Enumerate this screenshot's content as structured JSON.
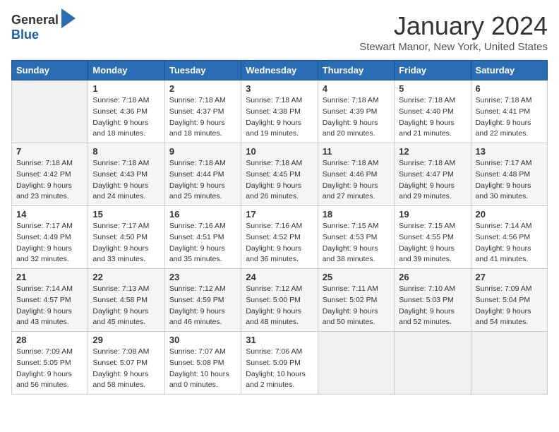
{
  "logo": {
    "general": "General",
    "blue": "Blue"
  },
  "title": "January 2024",
  "location": "Stewart Manor, New York, United States",
  "weekdays": [
    "Sunday",
    "Monday",
    "Tuesday",
    "Wednesday",
    "Thursday",
    "Friday",
    "Saturday"
  ],
  "weeks": [
    [
      {
        "day": "",
        "info": ""
      },
      {
        "day": "1",
        "info": "Sunrise: 7:18 AM\nSunset: 4:36 PM\nDaylight: 9 hours\nand 18 minutes."
      },
      {
        "day": "2",
        "info": "Sunrise: 7:18 AM\nSunset: 4:37 PM\nDaylight: 9 hours\nand 18 minutes."
      },
      {
        "day": "3",
        "info": "Sunrise: 7:18 AM\nSunset: 4:38 PM\nDaylight: 9 hours\nand 19 minutes."
      },
      {
        "day": "4",
        "info": "Sunrise: 7:18 AM\nSunset: 4:39 PM\nDaylight: 9 hours\nand 20 minutes."
      },
      {
        "day": "5",
        "info": "Sunrise: 7:18 AM\nSunset: 4:40 PM\nDaylight: 9 hours\nand 21 minutes."
      },
      {
        "day": "6",
        "info": "Sunrise: 7:18 AM\nSunset: 4:41 PM\nDaylight: 9 hours\nand 22 minutes."
      }
    ],
    [
      {
        "day": "7",
        "info": "Sunrise: 7:18 AM\nSunset: 4:42 PM\nDaylight: 9 hours\nand 23 minutes."
      },
      {
        "day": "8",
        "info": "Sunrise: 7:18 AM\nSunset: 4:43 PM\nDaylight: 9 hours\nand 24 minutes."
      },
      {
        "day": "9",
        "info": "Sunrise: 7:18 AM\nSunset: 4:44 PM\nDaylight: 9 hours\nand 25 minutes."
      },
      {
        "day": "10",
        "info": "Sunrise: 7:18 AM\nSunset: 4:45 PM\nDaylight: 9 hours\nand 26 minutes."
      },
      {
        "day": "11",
        "info": "Sunrise: 7:18 AM\nSunset: 4:46 PM\nDaylight: 9 hours\nand 27 minutes."
      },
      {
        "day": "12",
        "info": "Sunrise: 7:18 AM\nSunset: 4:47 PM\nDaylight: 9 hours\nand 29 minutes."
      },
      {
        "day": "13",
        "info": "Sunrise: 7:17 AM\nSunset: 4:48 PM\nDaylight: 9 hours\nand 30 minutes."
      }
    ],
    [
      {
        "day": "14",
        "info": "Sunrise: 7:17 AM\nSunset: 4:49 PM\nDaylight: 9 hours\nand 32 minutes."
      },
      {
        "day": "15",
        "info": "Sunrise: 7:17 AM\nSunset: 4:50 PM\nDaylight: 9 hours\nand 33 minutes."
      },
      {
        "day": "16",
        "info": "Sunrise: 7:16 AM\nSunset: 4:51 PM\nDaylight: 9 hours\nand 35 minutes."
      },
      {
        "day": "17",
        "info": "Sunrise: 7:16 AM\nSunset: 4:52 PM\nDaylight: 9 hours\nand 36 minutes."
      },
      {
        "day": "18",
        "info": "Sunrise: 7:15 AM\nSunset: 4:53 PM\nDaylight: 9 hours\nand 38 minutes."
      },
      {
        "day": "19",
        "info": "Sunrise: 7:15 AM\nSunset: 4:55 PM\nDaylight: 9 hours\nand 39 minutes."
      },
      {
        "day": "20",
        "info": "Sunrise: 7:14 AM\nSunset: 4:56 PM\nDaylight: 9 hours\nand 41 minutes."
      }
    ],
    [
      {
        "day": "21",
        "info": "Sunrise: 7:14 AM\nSunset: 4:57 PM\nDaylight: 9 hours\nand 43 minutes."
      },
      {
        "day": "22",
        "info": "Sunrise: 7:13 AM\nSunset: 4:58 PM\nDaylight: 9 hours\nand 45 minutes."
      },
      {
        "day": "23",
        "info": "Sunrise: 7:12 AM\nSunset: 4:59 PM\nDaylight: 9 hours\nand 46 minutes."
      },
      {
        "day": "24",
        "info": "Sunrise: 7:12 AM\nSunset: 5:00 PM\nDaylight: 9 hours\nand 48 minutes."
      },
      {
        "day": "25",
        "info": "Sunrise: 7:11 AM\nSunset: 5:02 PM\nDaylight: 9 hours\nand 50 minutes."
      },
      {
        "day": "26",
        "info": "Sunrise: 7:10 AM\nSunset: 5:03 PM\nDaylight: 9 hours\nand 52 minutes."
      },
      {
        "day": "27",
        "info": "Sunrise: 7:09 AM\nSunset: 5:04 PM\nDaylight: 9 hours\nand 54 minutes."
      }
    ],
    [
      {
        "day": "28",
        "info": "Sunrise: 7:09 AM\nSunset: 5:05 PM\nDaylight: 9 hours\nand 56 minutes."
      },
      {
        "day": "29",
        "info": "Sunrise: 7:08 AM\nSunset: 5:07 PM\nDaylight: 9 hours\nand 58 minutes."
      },
      {
        "day": "30",
        "info": "Sunrise: 7:07 AM\nSunset: 5:08 PM\nDaylight: 10 hours\nand 0 minutes."
      },
      {
        "day": "31",
        "info": "Sunrise: 7:06 AM\nSunset: 5:09 PM\nDaylight: 10 hours\nand 2 minutes."
      },
      {
        "day": "",
        "info": ""
      },
      {
        "day": "",
        "info": ""
      },
      {
        "day": "",
        "info": ""
      }
    ]
  ]
}
